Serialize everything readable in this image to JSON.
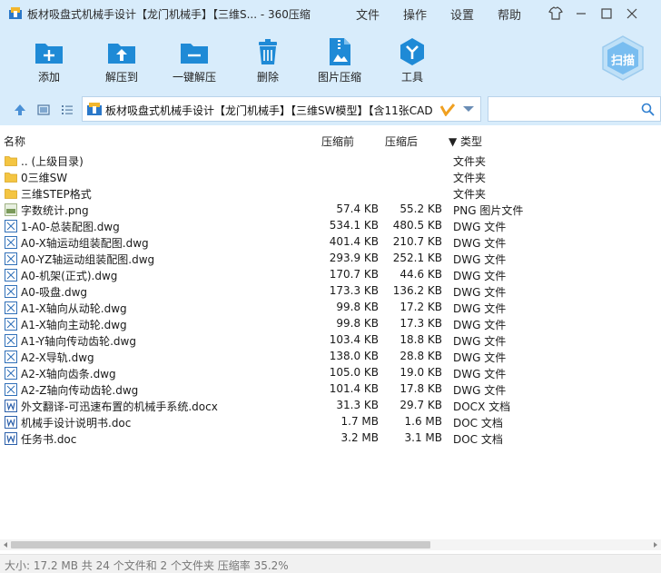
{
  "window": {
    "title": "板材吸盘式机械手设计【龙门机械手】【三维S... - 360压缩",
    "menu": [
      "文件",
      "操作",
      "设置",
      "帮助"
    ]
  },
  "toolbar": {
    "buttons": [
      {
        "label": "添加",
        "icon": "add-icon"
      },
      {
        "label": "解压到",
        "icon": "extract-to-icon"
      },
      {
        "label": "一键解压",
        "icon": "one-click-extract-icon"
      },
      {
        "label": "删除",
        "icon": "delete-icon"
      },
      {
        "label": "图片压缩",
        "icon": "image-compress-icon"
      },
      {
        "label": "工具",
        "icon": "tools-icon"
      }
    ],
    "scan_label": "扫描"
  },
  "address": {
    "path": "板材吸盘式机械手设计【龙门机械手】【三维SW模型】【含11张CAD",
    "search_placeholder": ""
  },
  "columns": {
    "name": "名称",
    "size": "压缩前",
    "compressed": "压缩后",
    "type": "▼ 类型"
  },
  "files": [
    {
      "name": ".. (上级目录)",
      "size": "",
      "compressed": "",
      "type": "文件夹",
      "kind": "folder"
    },
    {
      "name": "0三维SW",
      "size": "",
      "compressed": "",
      "type": "文件夹",
      "kind": "folder"
    },
    {
      "name": "三维STEP格式",
      "size": "",
      "compressed": "",
      "type": "文件夹",
      "kind": "folder"
    },
    {
      "name": "字数统计.png",
      "size": "57.4 KB",
      "compressed": "55.2 KB",
      "type": "PNG 图片文件",
      "kind": "png"
    },
    {
      "name": "1-A0-总装配图.dwg",
      "size": "534.1 KB",
      "compressed": "480.5 KB",
      "type": "DWG 文件",
      "kind": "dwg"
    },
    {
      "name": "A0-X轴运动组装配图.dwg",
      "size": "401.4 KB",
      "compressed": "210.7 KB",
      "type": "DWG 文件",
      "kind": "dwg"
    },
    {
      "name": "A0-YZ轴运动组装配图.dwg",
      "size": "293.9 KB",
      "compressed": "252.1 KB",
      "type": "DWG 文件",
      "kind": "dwg"
    },
    {
      "name": "A0-机架(正式).dwg",
      "size": "170.7 KB",
      "compressed": "44.6 KB",
      "type": "DWG 文件",
      "kind": "dwg"
    },
    {
      "name": "A0-吸盘.dwg",
      "size": "173.3 KB",
      "compressed": "136.2 KB",
      "type": "DWG 文件",
      "kind": "dwg"
    },
    {
      "name": "A1-X轴向从动轮.dwg",
      "size": "99.8 KB",
      "compressed": "17.2 KB",
      "type": "DWG 文件",
      "kind": "dwg"
    },
    {
      "name": "A1-X轴向主动轮.dwg",
      "size": "99.8 KB",
      "compressed": "17.3 KB",
      "type": "DWG 文件",
      "kind": "dwg"
    },
    {
      "name": "A1-Y轴向传动齿轮.dwg",
      "size": "103.4 KB",
      "compressed": "18.8 KB",
      "type": "DWG 文件",
      "kind": "dwg"
    },
    {
      "name": "A2-X导轨.dwg",
      "size": "138.0 KB",
      "compressed": "28.8 KB",
      "type": "DWG 文件",
      "kind": "dwg"
    },
    {
      "name": "A2-X轴向齿条.dwg",
      "size": "105.0 KB",
      "compressed": "19.0 KB",
      "type": "DWG 文件",
      "kind": "dwg"
    },
    {
      "name": "A2-Z轴向传动齿轮.dwg",
      "size": "101.4 KB",
      "compressed": "17.8 KB",
      "type": "DWG 文件",
      "kind": "dwg"
    },
    {
      "name": "外文翻译-可迅速布置的机械手系统.docx",
      "size": "31.3 KB",
      "compressed": "29.7 KB",
      "type": "DOCX 文档",
      "kind": "doc"
    },
    {
      "name": "机械手设计说明书.doc",
      "size": "1.7 MB",
      "compressed": "1.6 MB",
      "type": "DOC 文档",
      "kind": "doc"
    },
    {
      "name": "任务书.doc",
      "size": "3.2 MB",
      "compressed": "3.1 MB",
      "type": "DOC 文档",
      "kind": "doc"
    }
  ],
  "status": "大小: 17.2 MB 共 24 个文件和 2 个文件夹 压缩率 35.2%",
  "colors": {
    "chrome": "#d8ecfb",
    "accent": "#1f8ad6",
    "folder": "#f4c542"
  }
}
